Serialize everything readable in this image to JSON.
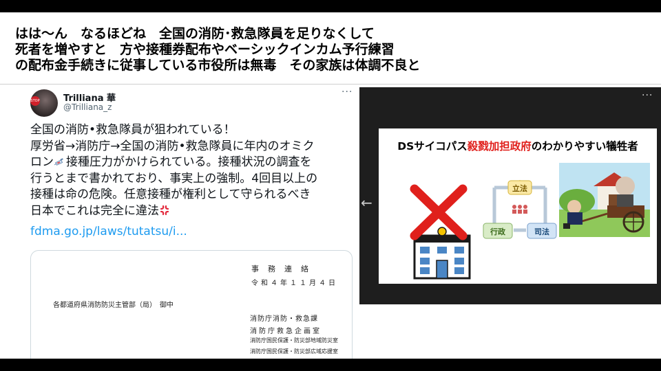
{
  "headline": {
    "line1": "はは〜ん　なるほどね　全国の消防･救急隊員を足りなくして",
    "line2": "死者を増やすと　方や接種券配布やベーシックインカム予行練習",
    "line3": "の配布金手続きに従事している市役所は無毒　その家族は体調不良と"
  },
  "tweet": {
    "display_name": "Trilliana 華",
    "handle": "@Trilliana_z",
    "more": "···",
    "avatar_badge": "STOP",
    "body": {
      "line1": "全国の消防•救急隊員が狙われている！",
      "line2": "厚労省→消防庁→全国の消防•救急隊員に年内のオミク",
      "line3a": "ロン",
      "line3b": "接種圧力がかけられている。接種状況の調査を",
      "line4": "行うとまで書かれており、事実上の強制。4回目以上の",
      "line5": "接種は命の危険。任意接種が権利として守られるべき",
      "line6": "日本でこれは完全に違法"
    },
    "link": "fdma.go.jp/laws/tutatsu/i...",
    "document": {
      "header": "事務連絡",
      "date": "令和４年１１月４日",
      "recipient": "各都道府県消防防災主管部（局）　御中",
      "sender1": "消防庁消防・救急課",
      "sender2": "消防庁救急企画室",
      "sender3": "消防庁国民保護・防災部地域防災室",
      "sender4": "消防庁国民保護・防災部広域応援室"
    }
  },
  "viewer": {
    "more": "···",
    "prev": "←",
    "slide": {
      "title_prefix": "DSサイコパス",
      "title_red": "殺戮加担政府",
      "title_suffix": "のわかりやすい犠牲者",
      "legislature": "立法",
      "executive": "行政",
      "judiciary": "司法"
    }
  },
  "colors": {
    "red": "#e0201c",
    "link": "#1d9bf0",
    "viewer_bg": "#1e1e1e"
  }
}
